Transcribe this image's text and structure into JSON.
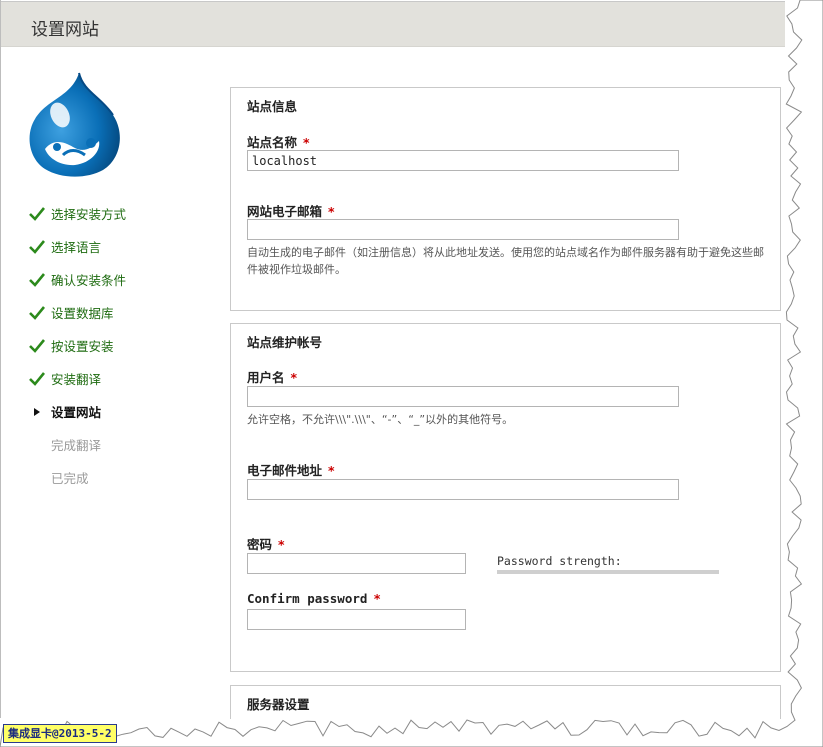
{
  "header": {
    "title": "设置网站"
  },
  "steps": [
    {
      "label": "选择安装方式",
      "state": "done"
    },
    {
      "label": "选择语言",
      "state": "done"
    },
    {
      "label": "确认安装条件",
      "state": "done"
    },
    {
      "label": "设置数据库",
      "state": "done"
    },
    {
      "label": "按设置安装",
      "state": "done"
    },
    {
      "label": "安装翻译",
      "state": "done"
    },
    {
      "label": "设置网站",
      "state": "active"
    },
    {
      "label": "完成翻译",
      "state": "todo"
    },
    {
      "label": "已完成",
      "state": "todo"
    }
  ],
  "site_info": {
    "legend": "站点信息",
    "name_label": "站点名称",
    "name_value": "localhost",
    "email_label": "网站电子邮箱",
    "email_value": "",
    "email_desc": "自动生成的电子邮件（如注册信息）将从此地址发送。使用您的站点域名作为邮件服务器有助于避免这些邮件被视作垃圾邮件。"
  },
  "account": {
    "legend": "站点维护帐号",
    "username_label": "用户名",
    "username_value": "",
    "username_desc": "允许空格，不允许\\\\\\\".\\\\\\\"、“-”、“_”以外的其他符号。",
    "email_label": "电子邮件地址",
    "email_value": "",
    "password_label": "密码",
    "password_value": "",
    "password_strength_label": "Password strength:",
    "password_strength_level": 0,
    "confirm_label": "Confirm password",
    "confirm_value": ""
  },
  "server": {
    "legend": "服务器设置"
  },
  "required_mark": "*",
  "watermark": "集成显卡@2013-5-2",
  "colors": {
    "header_bg": "#e2e1dc",
    "done": "#1e6b10",
    "required": "#cc0000",
    "logo_blue": "#0077c0"
  },
  "icons": {
    "done": "check-icon",
    "active": "triangle-right-icon"
  }
}
